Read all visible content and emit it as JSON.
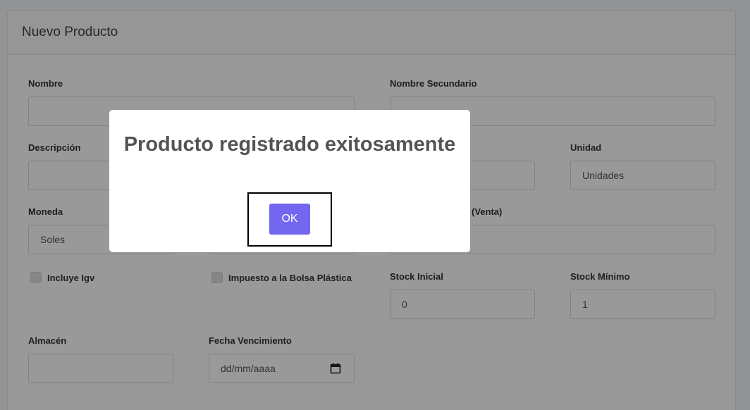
{
  "card": {
    "title": "Nuevo Producto"
  },
  "form": {
    "nombre_label": "Nombre",
    "nombre_value": "",
    "nombre_secundario_label": "Nombre Secundario",
    "nombre_secundario_value": "",
    "descripcion_label": "Descripción",
    "descripcion_value": "",
    "unidad_label": "Unidad",
    "unidad_value": "Unidades",
    "moneda_label": "Moneda",
    "moneda_value": "Soles",
    "precio_venta_label": "(Venta)",
    "incluye_igv_label": "Incluye Igv",
    "impuesto_bolsa_label": "Impuesto a la Bolsa Plástica",
    "stock_inicial_label": "Stock Inicial",
    "stock_inicial_value": "0",
    "stock_minimo_label": "Stock Mínimo",
    "stock_minimo_value": "1",
    "almacen_label": "Almacén",
    "almacen_value": "",
    "fecha_vencimiento_label": "Fecha Vencimiento",
    "fecha_vencimiento_value": "dd/mm/aaaa"
  },
  "modal": {
    "title": "Producto registrado exitosamente",
    "ok_label": "OK",
    "ok_color": "#7367f0"
  }
}
